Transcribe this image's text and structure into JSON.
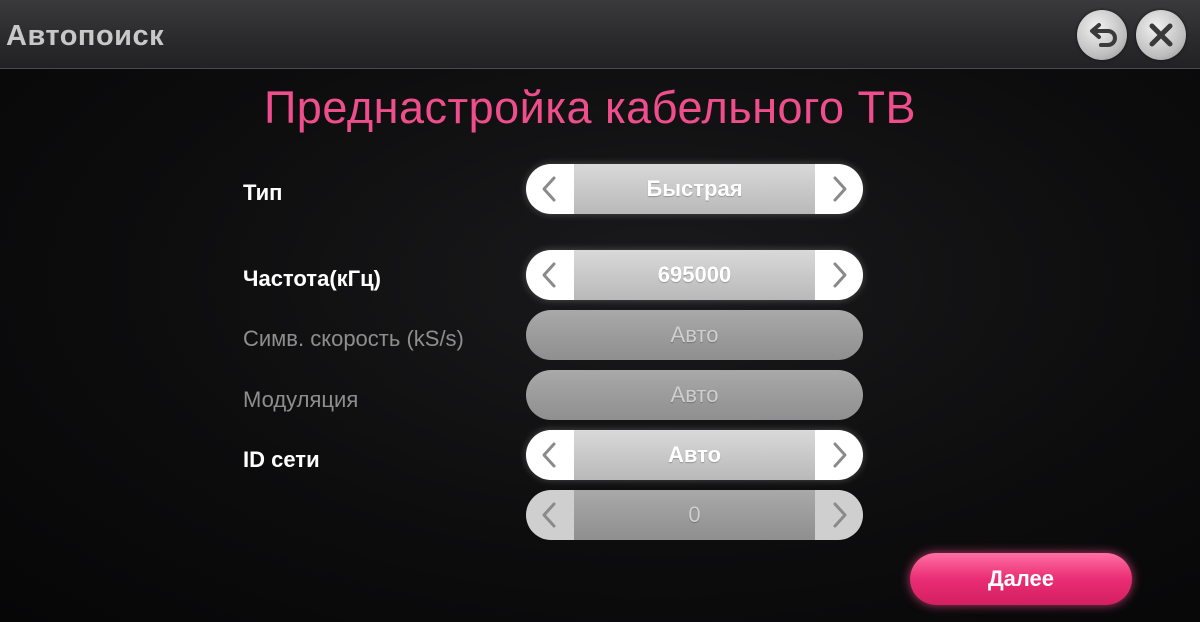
{
  "header": {
    "title": "Автопоиск"
  },
  "main": {
    "title": "Преднастройка кабельного ТВ"
  },
  "settings": {
    "type": {
      "label": "Тип",
      "value": "Быстрая"
    },
    "frequency": {
      "label": "Частота(кГц)",
      "value": "695000"
    },
    "symbol_rate": {
      "label": "Симв. скорость (kS/s)",
      "value": "Авто"
    },
    "modulation": {
      "label": "Модуляция",
      "value": "Авто"
    },
    "network_id": {
      "label": "ID сети",
      "value": "Авто"
    },
    "network_id_number": {
      "value": "0"
    }
  },
  "footer": {
    "next_label": "Далее"
  },
  "colors": {
    "accent": "#ef4d8c",
    "button": "#ea2d74"
  },
  "icons": {
    "back": "back-arrow-icon",
    "close": "close-icon",
    "left": "chevron-left-icon",
    "right": "chevron-right-icon"
  }
}
